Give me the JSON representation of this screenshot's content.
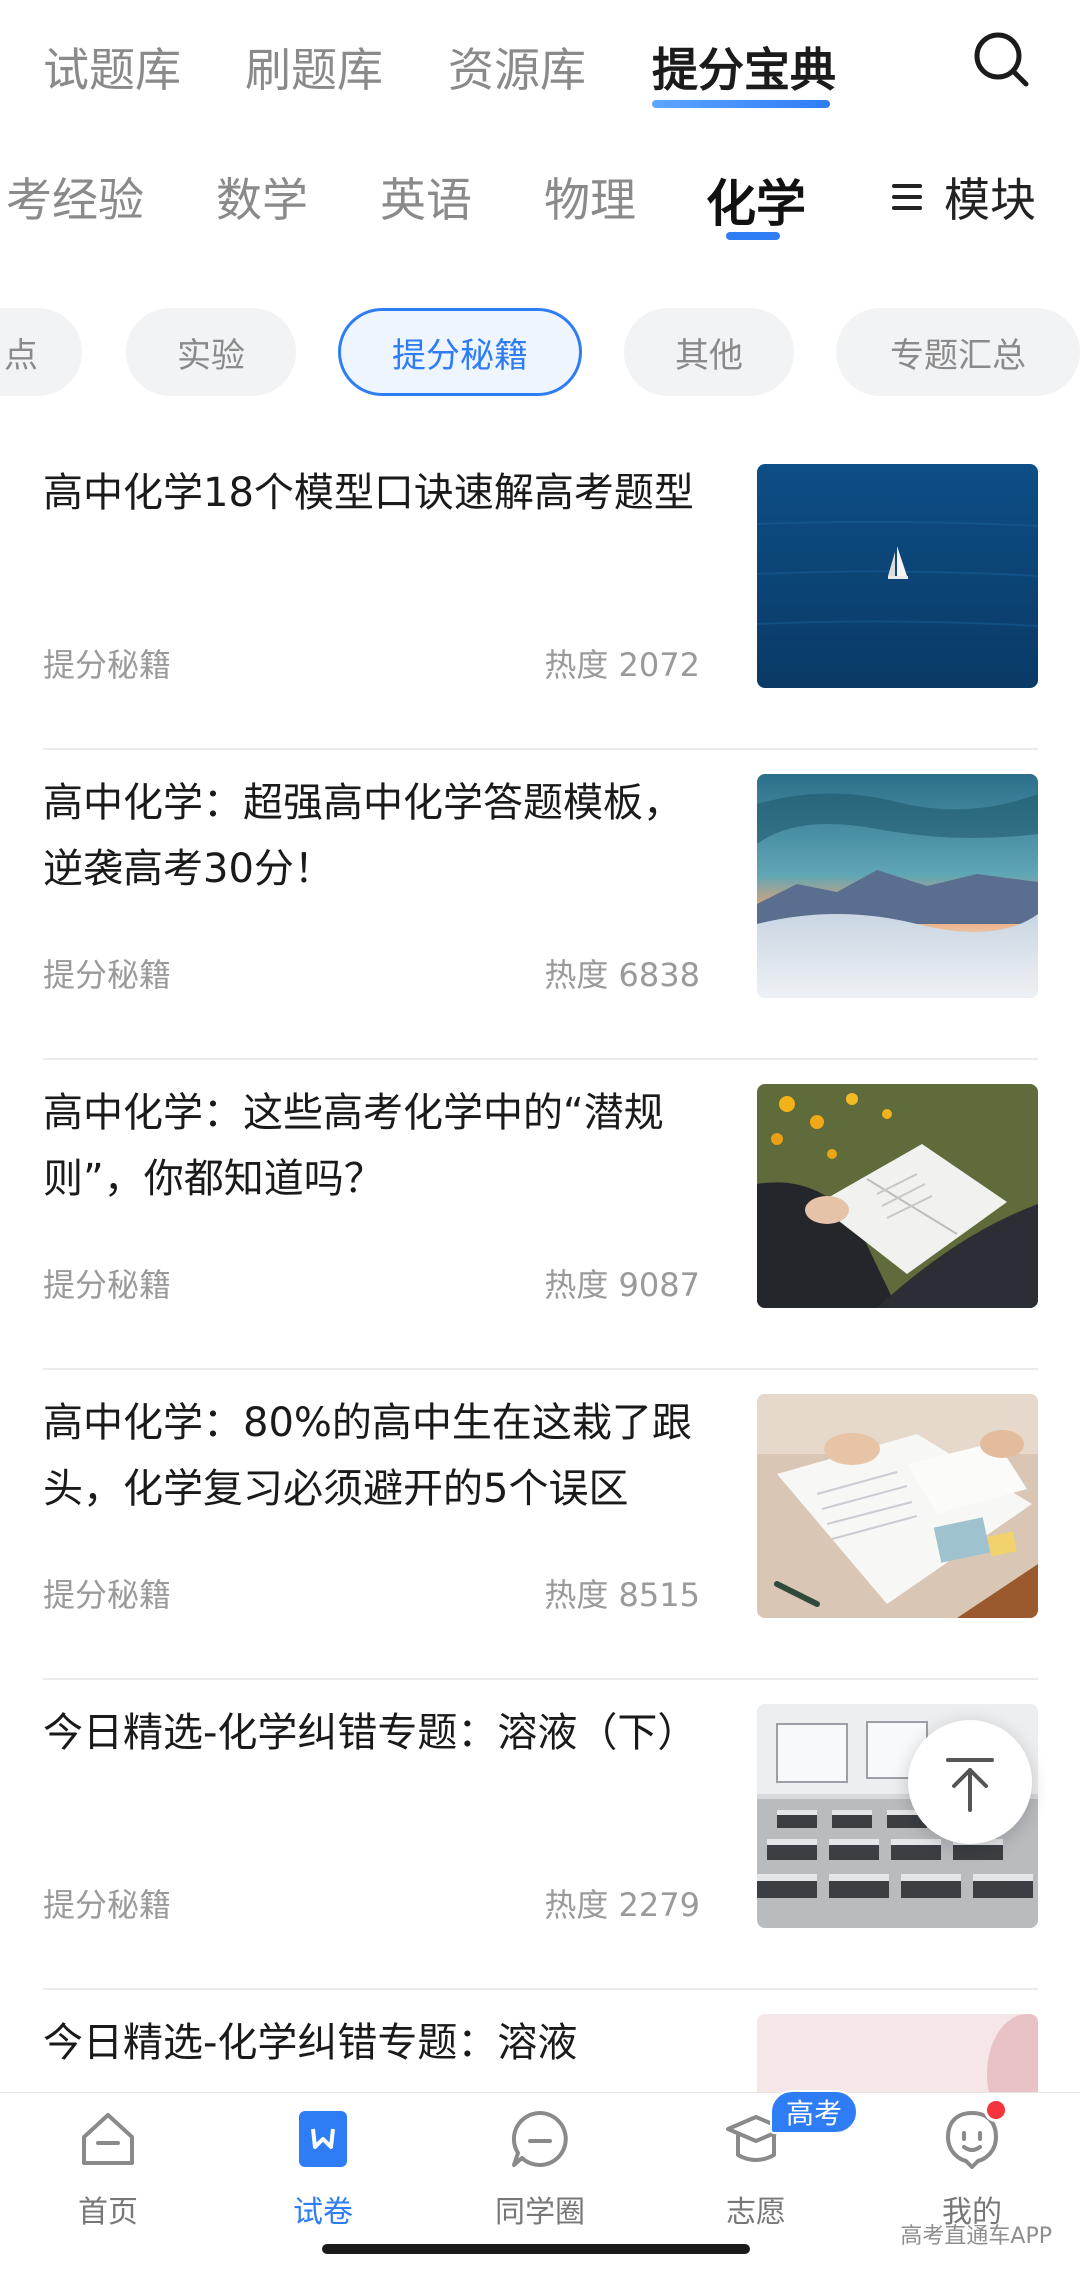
{
  "top_tabs": [
    "试题库",
    "刷题库",
    "资源库",
    "提分宝典"
  ],
  "top_tab_active": "提分宝典",
  "subject_tabs": [
    "考经验",
    "数学",
    "英语",
    "物理",
    "化学"
  ],
  "subject_active": "化学",
  "module_label": "模块",
  "chips": [
    "点",
    "实验",
    "提分秘籍",
    "其他",
    "专题汇总"
  ],
  "chip_active": "提分秘籍",
  "articles": [
    {
      "title": "高中化学18个模型口诀速解高考题型",
      "tag": "提分秘籍",
      "heat": "热度 2072",
      "image": "sea-sailboat"
    },
    {
      "title": "高中化学：超强高中化学答题模板，逆袭高考30分！",
      "tag": "提分秘籍",
      "heat": "热度 6838",
      "image": "desert-sunset"
    },
    {
      "title": "高中化学：这些高考化学中的“潜规则”，你都知道吗？",
      "tag": "提分秘籍",
      "heat": "热度 9087",
      "image": "reading-book"
    },
    {
      "title": "高中化学：80%的高中生在这栽了跟头，化学复习必须避开的5个误区",
      "tag": "提分秘籍",
      "heat": "热度 8515",
      "image": "writing-desk"
    },
    {
      "title": "今日精选-化学纠错专题：溶液（下）",
      "tag": "提分秘籍",
      "heat": "热度 2279",
      "image": "classroom"
    },
    {
      "title": "今日精选-化学纠错专题：溶液",
      "tag": "",
      "heat": "",
      "image": "pink-blur"
    }
  ],
  "bottom_nav": [
    {
      "label": "首页",
      "icon": "home-icon"
    },
    {
      "label": "试卷",
      "icon": "paper-icon"
    },
    {
      "label": "同学圈",
      "icon": "chat-icon"
    },
    {
      "label": "志愿",
      "icon": "graduation-cap-icon"
    },
    {
      "label": "我的",
      "icon": "profile-icon"
    }
  ],
  "bottom_nav_active": "试卷",
  "nav_badge": "高考",
  "watermark": "高考直通车APP",
  "colors": {
    "accent": "#2e7df5",
    "badge_dot": "#f5353b"
  }
}
